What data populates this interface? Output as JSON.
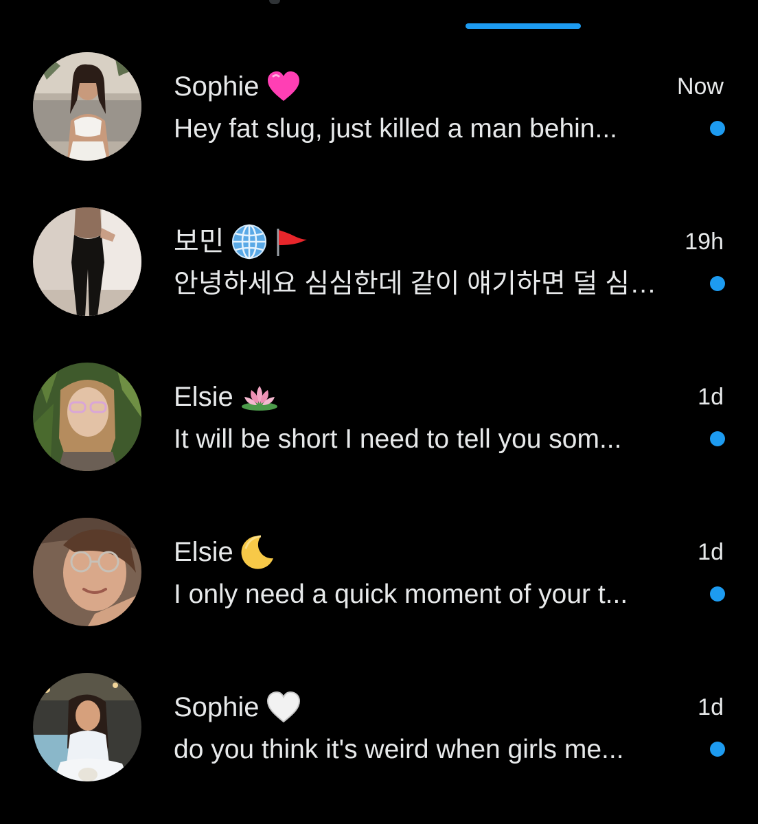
{
  "colors": {
    "background": "#000000",
    "text": "#e7e9ea",
    "accent": "#1d9bf0"
  },
  "conversations": [
    {
      "name": "Sophie",
      "emoji_icon": "pink-heart-icon",
      "time": "Now",
      "preview": "Hey fat slug, just killed a man behin...",
      "unread": true
    },
    {
      "name": "보민",
      "emoji_icon": "globe-icon",
      "emoji_icon_2": "red-flag-icon",
      "time": "19h",
      "preview": "안녕하세요 심심한데 같이 얘기하면 덜 심…",
      "unread": true
    },
    {
      "name": "Elsie",
      "emoji_icon": "lotus-icon",
      "time": "1d",
      "preview": "It will be short I need to tell you som...",
      "unread": true
    },
    {
      "name": "Elsie",
      "emoji_icon": "crescent-moon-icon",
      "time": "1d",
      "preview": "I only need a quick moment of your t...",
      "unread": true
    },
    {
      "name": "Sophie",
      "emoji_icon": "white-heart-icon",
      "time": "1d",
      "preview": "do you think it's weird when girls me...",
      "unread": true
    }
  ]
}
